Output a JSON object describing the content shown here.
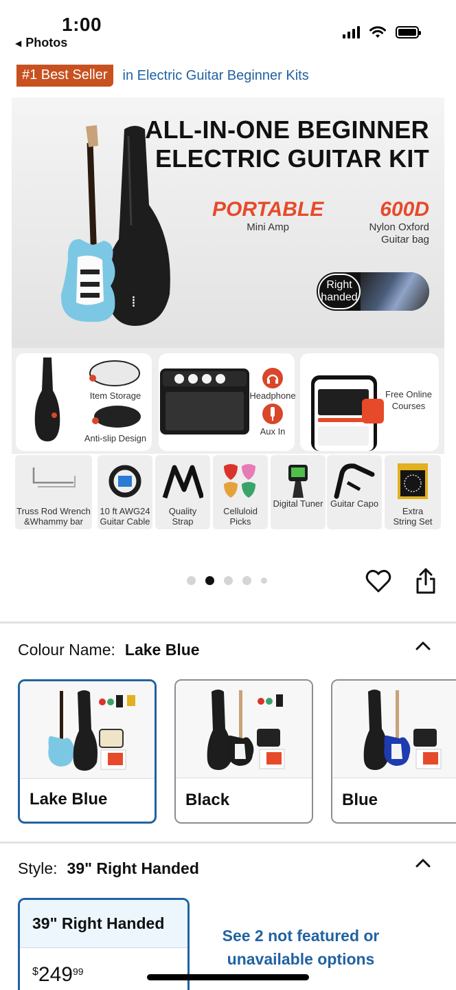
{
  "status_bar": {
    "time": "1:00",
    "back_app": "Photos"
  },
  "bestseller": {
    "badge": "#1 Best Seller",
    "category": "in Electric Guitar Beginner Kits"
  },
  "hero": {
    "title_line1": "ALL-IN-ONE BEGINNER",
    "title_line2": "ELECTRIC GUITAR KIT",
    "feature_amp_big": "PORTABLE",
    "feature_amp_small": "Mini Amp",
    "feature_bag_big": "600D",
    "feature_bag_small1": "Nylon Oxford",
    "feature_bag_small2": "Guitar bag",
    "right_handed_1": "Right",
    "right_handed_2": "handed",
    "card1_label1": "Item Storage",
    "card1_label2": "Anti-slip Design",
    "card2_label1": "Headphone",
    "card2_label2": "Aux In",
    "card3_label1": "Free Online",
    "card3_label2": "Courses",
    "accessories": [
      {
        "line1": "Truss Rod Wrench",
        "line2": "&Whammy bar"
      },
      {
        "line1": "10 ft AWG24",
        "line2": "Guitar Cable"
      },
      {
        "line1": "Quality",
        "line2": "Strap"
      },
      {
        "line1": "Celluloid",
        "line2": "Picks"
      },
      {
        "line1": "Digital Tuner",
        "line2": ""
      },
      {
        "line1": "Guitar Capo",
        "line2": ""
      },
      {
        "line1": "Extra",
        "line2": "String Set"
      }
    ]
  },
  "gallery": {
    "dot_count": 5,
    "active_index": 1
  },
  "colour": {
    "label": "Colour Name:",
    "selected": "Lake Blue",
    "options": [
      {
        "name": "Lake Blue",
        "body_color": "#7cc8e4"
      },
      {
        "name": "Black",
        "body_color": "#1c1c1c"
      },
      {
        "name": "Blue",
        "body_color": "#1f3bb0"
      }
    ]
  },
  "style": {
    "label": "Style:",
    "selected": "39\" Right Handed",
    "option_name": "39\" Right Handed",
    "price_currency": "$",
    "price_whole": "249",
    "price_fraction": "99",
    "not_featured": "See 2 not featured or unavailable options"
  },
  "colors": {
    "accent_blue": "#2162a1",
    "badge_orange": "#c7511f",
    "hero_red": "#e64a2a"
  }
}
